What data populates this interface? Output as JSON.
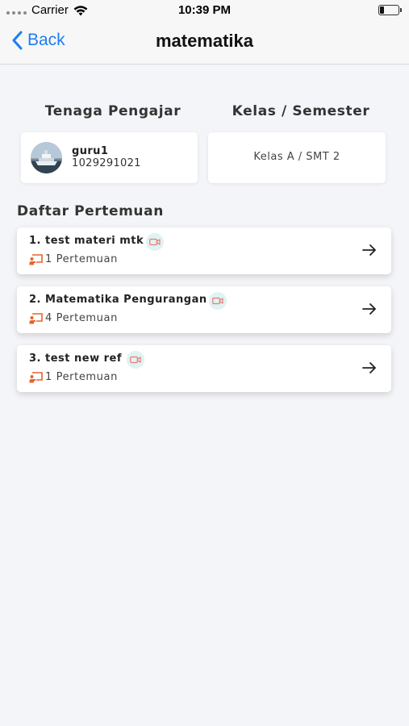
{
  "status_bar": {
    "carrier": "Carrier",
    "time": "10:39 PM"
  },
  "nav": {
    "back_label": "Back",
    "title": "matematika"
  },
  "teacher": {
    "header": "Tenaga Pengajar",
    "name": "guru1",
    "id": "1029291021"
  },
  "class_info": {
    "header": "Kelas / Semester",
    "value": "Kelas A / SMT 2"
  },
  "meetings_section": {
    "title": "Daftar Pertemuan",
    "items": [
      {
        "title": "1. test materi mtk",
        "count": "1 Pertemuan"
      },
      {
        "title": "2. Matematika Pengurangan",
        "count": "4 Pertemuan"
      },
      {
        "title": "3. test new ref",
        "count": "1 Pertemuan"
      }
    ]
  },
  "colors": {
    "accent": "#1f7cf2",
    "meeting_icon": "#e8622c",
    "video_icon": "#e87a7a",
    "video_badge_bg": "#dff3f2"
  },
  "icons": [
    "wifi-icon",
    "battery-icon",
    "chevron-left-icon",
    "video-camera-icon",
    "presentation-icon",
    "arrow-right-icon"
  ]
}
